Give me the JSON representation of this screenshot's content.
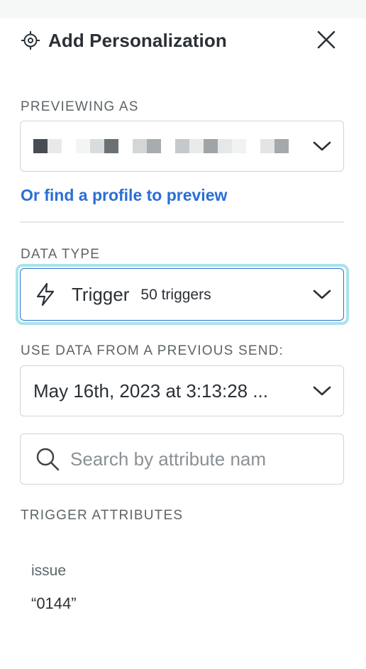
{
  "header": {
    "title": "Add Personalization",
    "icon": "crosshair-icon",
    "close_icon": "close-icon"
  },
  "previewing": {
    "label": "PREVIEWING AS",
    "selected_value": "",
    "redacted": true
  },
  "find_profile_link": "Or find a profile to preview",
  "data_type": {
    "label": "DATA TYPE",
    "icon": "lightning-icon",
    "value": "Trigger",
    "count": "50 triggers"
  },
  "previous_send": {
    "label": "USE DATA FROM A PREVIOUS SEND:",
    "value": "May 16th, 2023 at 3:13:28 ..."
  },
  "search": {
    "placeholder": "Search by attribute nam",
    "value": ""
  },
  "attributes": {
    "label": "TRIGGER ATTRIBUTES",
    "items": [
      {
        "name": "issue",
        "value": "“0144”"
      }
    ]
  },
  "colors": {
    "accent": "#2a6ed5",
    "focus_ring": "#a9e3e8",
    "border": "#cfd4d6",
    "text": "#2b3036",
    "muted": "#5d6468"
  }
}
